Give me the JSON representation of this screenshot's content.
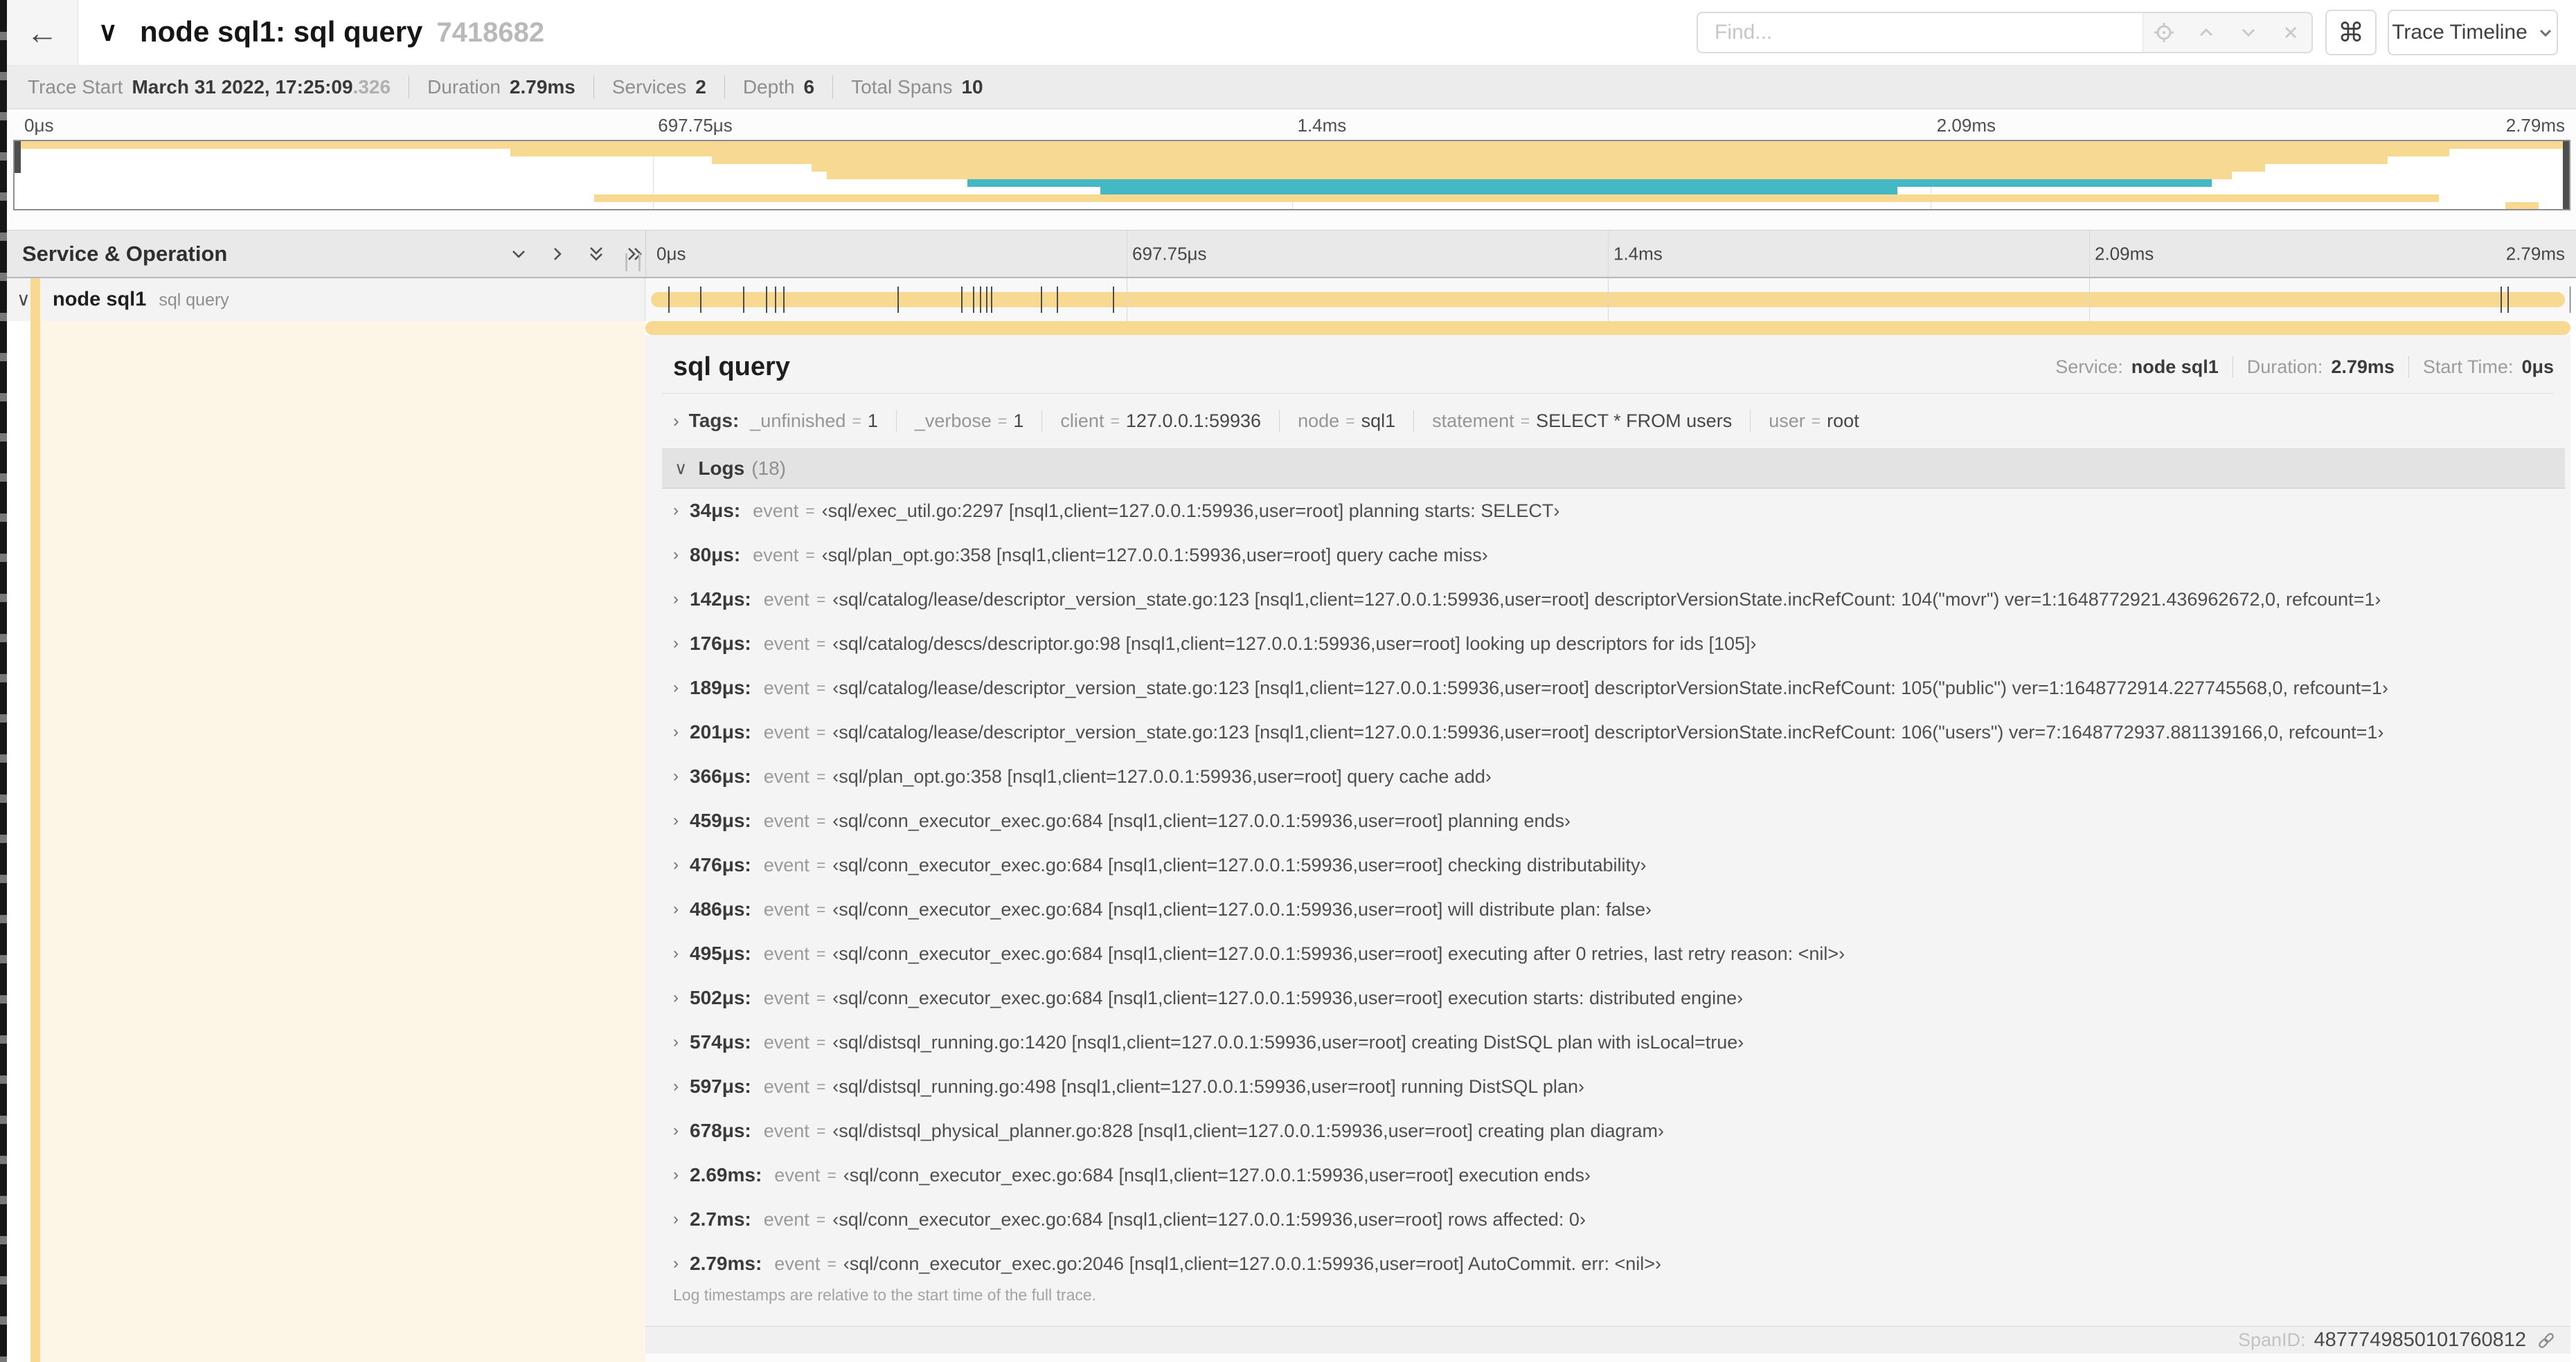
{
  "colors": {
    "tan": "#f8d992",
    "teal": "#45b8c6"
  },
  "icons": {
    "back": "←",
    "caret_down": "∨",
    "caret_right": "›",
    "shortcut_key": "⌘"
  },
  "header": {
    "title": "node sql1: sql query",
    "trace_id": "7418682",
    "find_placeholder": "Find...",
    "find_value": "",
    "view_dropdown_label": "Trace Timeline"
  },
  "trace_info": {
    "items": [
      {
        "label": "Trace Start",
        "value": "March 31 2022, 17:25:09",
        "suffix": ".326"
      },
      {
        "label": "Duration",
        "value": "2.79ms",
        "suffix": ""
      },
      {
        "label": "Services",
        "value": "2",
        "suffix": ""
      },
      {
        "label": "Depth",
        "value": "6",
        "suffix": ""
      },
      {
        "label": "Total Spans",
        "value": "10",
        "suffix": ""
      }
    ]
  },
  "timeline": {
    "ticks": [
      {
        "label": "0μs",
        "frac": 0
      },
      {
        "label": "697.75μs",
        "frac": 0.25
      },
      {
        "label": "1.4ms",
        "frac": 0.5
      },
      {
        "label": "2.09ms",
        "frac": 0.75
      },
      {
        "label": "2.79ms",
        "frac": 1
      }
    ],
    "grid_fracs": [
      0.25,
      0.5,
      0.75
    ],
    "minimap_spans": [
      {
        "row": 0,
        "start": 0,
        "end": 1,
        "color": "tan"
      },
      {
        "row": 1,
        "start": 0.194,
        "end": 0.953,
        "color": "tan"
      },
      {
        "row": 2,
        "start": 0.273,
        "end": 0.929,
        "color": "tan"
      },
      {
        "row": 3,
        "start": 0.312,
        "end": 0.881,
        "color": "tan"
      },
      {
        "row": 4,
        "start": 0.318,
        "end": 0.868,
        "color": "tan"
      },
      {
        "row": 5,
        "start": 0.373,
        "end": 0.86,
        "color": "teal"
      },
      {
        "row": 6,
        "start": 0.425,
        "end": 0.737,
        "color": "teal"
      },
      {
        "row": 7,
        "start": 0.227,
        "end": 0.949,
        "color": "tan"
      },
      {
        "row": 8,
        "start": 0.975,
        "end": 0.988,
        "color": "tan"
      }
    ]
  },
  "span_table": {
    "header": "Service & Operation",
    "row": {
      "service": "node sql1",
      "operation": "sql query",
      "bar_color": "tan"
    }
  },
  "detail": {
    "title": "sql query",
    "meta": [
      {
        "label": "Service:",
        "value": "node sql1"
      },
      {
        "label": "Duration:",
        "value": "2.79ms"
      },
      {
        "label": "Start Time:",
        "value": "0μs"
      }
    ],
    "tags_label": "Tags:",
    "tags": [
      {
        "key": "_unfinished",
        "value": "1"
      },
      {
        "key": "_verbose",
        "value": "1"
      },
      {
        "key": "client",
        "value": "127.0.0.1:59936"
      },
      {
        "key": "node",
        "value": "sql1"
      },
      {
        "key": "statement",
        "value": "SELECT * FROM users"
      },
      {
        "key": "user",
        "value": "root"
      }
    ],
    "logs_label": "Logs",
    "logs_count": "(18)",
    "logs": [
      {
        "time": "34μs:",
        "field": "event",
        "frac": 0.0122,
        "value": "‹sql/exec_util.go:2297 [nsql1,client=127.0.0.1:59936,user=root] planning starts: SELECT›"
      },
      {
        "time": "80μs:",
        "field": "event",
        "frac": 0.0287,
        "value": "‹sql/plan_opt.go:358 [nsql1,client=127.0.0.1:59936,user=root] query cache miss›"
      },
      {
        "time": "142μs:",
        "field": "event",
        "frac": 0.0509,
        "value": "‹sql/catalog/lease/descriptor_version_state.go:123 [nsql1,client=127.0.0.1:59936,user=root] descriptorVersionState.incRefCount: 104(\"movr\") ver=1:1648772921.436962672,0, refcount=1›"
      },
      {
        "time": "176μs:",
        "field": "event",
        "frac": 0.0631,
        "value": "‹sql/catalog/descs/descriptor.go:98 [nsql1,client=127.0.0.1:59936,user=root] looking up descriptors for ids [105]›"
      },
      {
        "time": "189μs:",
        "field": "event",
        "frac": 0.0677,
        "value": "‹sql/catalog/lease/descriptor_version_state.go:123 [nsql1,client=127.0.0.1:59936,user=root] descriptorVersionState.incRefCount: 105(\"public\") ver=1:1648772914.227745568,0, refcount=1›"
      },
      {
        "time": "201μs:",
        "field": "event",
        "frac": 0.072,
        "value": "‹sql/catalog/lease/descriptor_version_state.go:123 [nsql1,client=127.0.0.1:59936,user=root] descriptorVersionState.incRefCount: 106(\"users\") ver=7:1648772937.881139166,0, refcount=1›"
      },
      {
        "time": "366μs:",
        "field": "event",
        "frac": 0.1312,
        "value": "‹sql/plan_opt.go:358 [nsql1,client=127.0.0.1:59936,user=root] query cache add›"
      },
      {
        "time": "459μs:",
        "field": "event",
        "frac": 0.1645,
        "value": "‹sql/conn_executor_exec.go:684 [nsql1,client=127.0.0.1:59936,user=root] planning ends›"
      },
      {
        "time": "476μs:",
        "field": "event",
        "frac": 0.1706,
        "value": "‹sql/conn_executor_exec.go:684 [nsql1,client=127.0.0.1:59936,user=root] checking distributability›"
      },
      {
        "time": "486μs:",
        "field": "event",
        "frac": 0.1742,
        "value": "‹sql/conn_executor_exec.go:684 [nsql1,client=127.0.0.1:59936,user=root] will distribute plan: false›"
      },
      {
        "time": "495μs:",
        "field": "event",
        "frac": 0.1774,
        "value": "‹sql/conn_executor_exec.go:684 [nsql1,client=127.0.0.1:59936,user=root] executing after 0 retries, last retry reason: <nil>›"
      },
      {
        "time": "502μs:",
        "field": "event",
        "frac": 0.1799,
        "value": "‹sql/conn_executor_exec.go:684 [nsql1,client=127.0.0.1:59936,user=root] execution starts: distributed engine›"
      },
      {
        "time": "574μs:",
        "field": "event",
        "frac": 0.2057,
        "value": "‹sql/distsql_running.go:1420 [nsql1,client=127.0.0.1:59936,user=root] creating DistSQL plan with isLocal=true›"
      },
      {
        "time": "597μs:",
        "field": "event",
        "frac": 0.214,
        "value": "‹sql/distsql_running.go:498 [nsql1,client=127.0.0.1:59936,user=root] running DistSQL plan›"
      },
      {
        "time": "678μs:",
        "field": "event",
        "frac": 0.243,
        "value": "‹sql/distsql_physical_planner.go:828 [nsql1,client=127.0.0.1:59936,user=root] creating plan diagram›"
      },
      {
        "time": "2.69ms:",
        "field": "event",
        "frac": 0.9642,
        "value": "‹sql/conn_executor_exec.go:684 [nsql1,client=127.0.0.1:59936,user=root] execution ends›"
      },
      {
        "time": "2.7ms:",
        "field": "event",
        "frac": 0.9677,
        "value": "‹sql/conn_executor_exec.go:684 [nsql1,client=127.0.0.1:59936,user=root] rows affected: 0›"
      },
      {
        "time": "2.79ms:",
        "field": "event",
        "frac": 1.0,
        "value": "‹sql/conn_executor_exec.go:2046 [nsql1,client=127.0.0.1:59936,user=root] AutoCommit. err: <nil>›"
      }
    ],
    "logs_note": "Log timestamps are relative to the start time of the full trace.",
    "span_id_label": "SpanID:",
    "span_id": "4877749850101760812"
  }
}
